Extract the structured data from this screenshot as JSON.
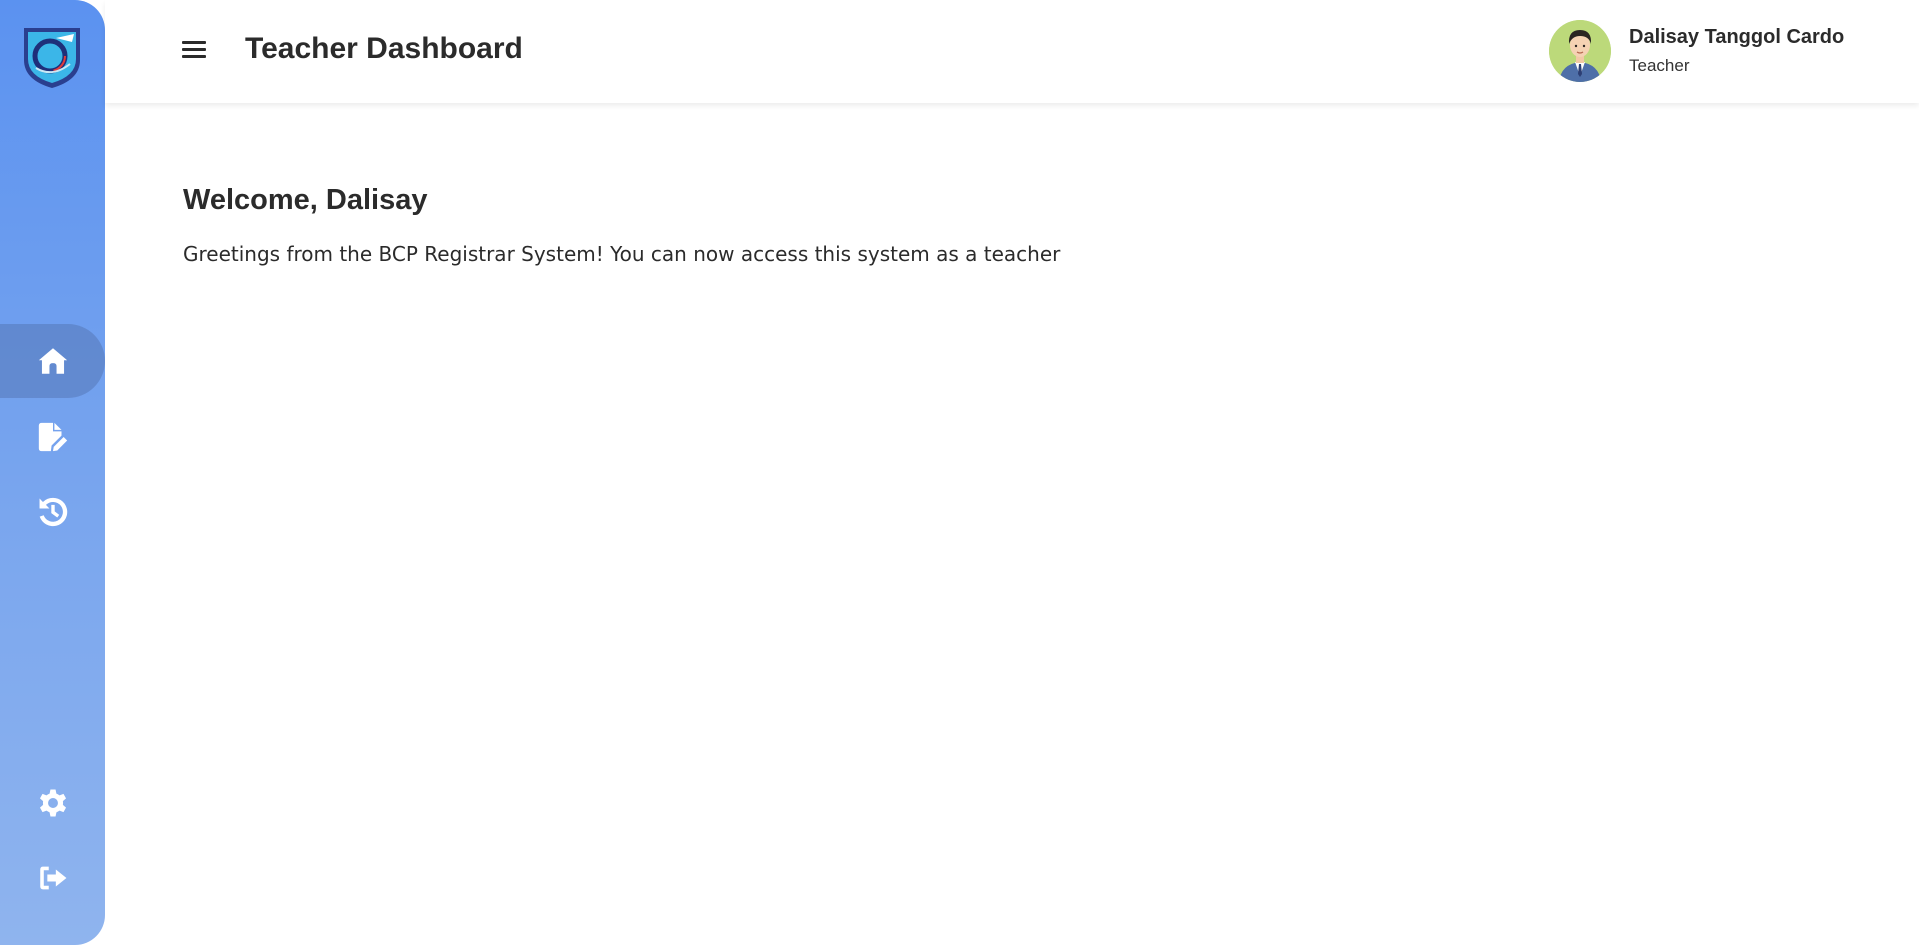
{
  "header": {
    "title": "Teacher Dashboard",
    "menu_icon": "hamburger-menu-icon"
  },
  "user": {
    "name": "Dalisay Tanggol Cardo",
    "role": "Teacher"
  },
  "sidebar": {
    "items": [
      {
        "icon": "home-icon",
        "active": true
      },
      {
        "icon": "file-edit-icon",
        "active": false
      },
      {
        "icon": "history-icon",
        "active": false
      },
      {
        "icon": "gear-icon",
        "active": false
      },
      {
        "icon": "logout-icon",
        "active": false
      }
    ]
  },
  "main": {
    "welcome": "Welcome, Dalisay",
    "greeting": "Greetings from the BCP Registrar System! You can now access this system as a teacher"
  },
  "colors": {
    "sidebar_top": "#5b92f0",
    "sidebar_bottom": "#8fb4ee",
    "text": "#2b2b2b"
  }
}
